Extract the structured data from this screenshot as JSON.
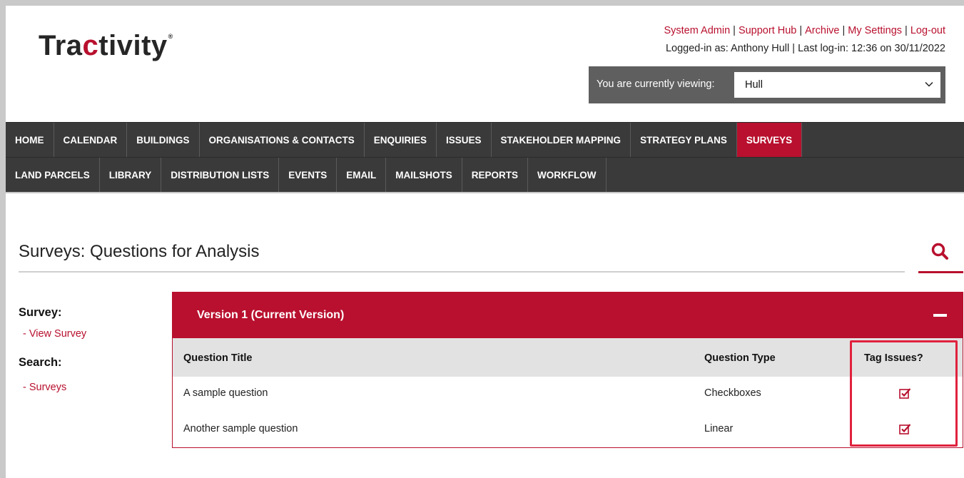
{
  "brand": {
    "logo_pre": "Tra",
    "logo_accent": "c",
    "logo_post": "tivity",
    "reg": "®"
  },
  "header": {
    "links": [
      "System Admin",
      "Support Hub",
      "Archive",
      "My Settings",
      "Log-out"
    ],
    "login_info": "Logged-in as: Anthony Hull | Last log-in: 12:36 on 30/11/2022",
    "viewing_label": "You are currently viewing:",
    "viewing_value": "Hull"
  },
  "nav_row1": [
    {
      "label": "HOME"
    },
    {
      "label": "CALENDAR"
    },
    {
      "label": "BUILDINGS"
    },
    {
      "label": "ORGANISATIONS & CONTACTS"
    },
    {
      "label": "ENQUIRIES"
    },
    {
      "label": "ISSUES"
    },
    {
      "label": "STAKEHOLDER MAPPING"
    },
    {
      "label": "STRATEGY PLANS"
    },
    {
      "label": "SURVEYS",
      "active": true
    }
  ],
  "nav_row2": [
    {
      "label": "LAND PARCELS"
    },
    {
      "label": "LIBRARY"
    },
    {
      "label": "DISTRIBUTION LISTS"
    },
    {
      "label": "EVENTS"
    },
    {
      "label": "EMAIL"
    },
    {
      "label": "MAILSHOTS"
    },
    {
      "label": "REPORTS"
    },
    {
      "label": "WORKFLOW"
    }
  ],
  "page_title": "Surveys: Questions for Analysis",
  "sidebar": {
    "survey_heading": "Survey:",
    "survey_link": "- View Survey",
    "search_heading": "Search:",
    "search_link": "- Surveys"
  },
  "panel": {
    "title": "Version 1 (Current Version)",
    "columns": [
      "Question Title",
      "Question Type",
      "Tag Issues?"
    ],
    "rows": [
      {
        "title": "A sample question",
        "type": "Checkboxes",
        "tag_issues": true
      },
      {
        "title": "Another sample question",
        "type": "Linear",
        "tag_issues": true
      }
    ]
  },
  "colors": {
    "accent": "#b8102e",
    "nav_bg": "#3a3a3a",
    "highlight": "#e0213d"
  }
}
